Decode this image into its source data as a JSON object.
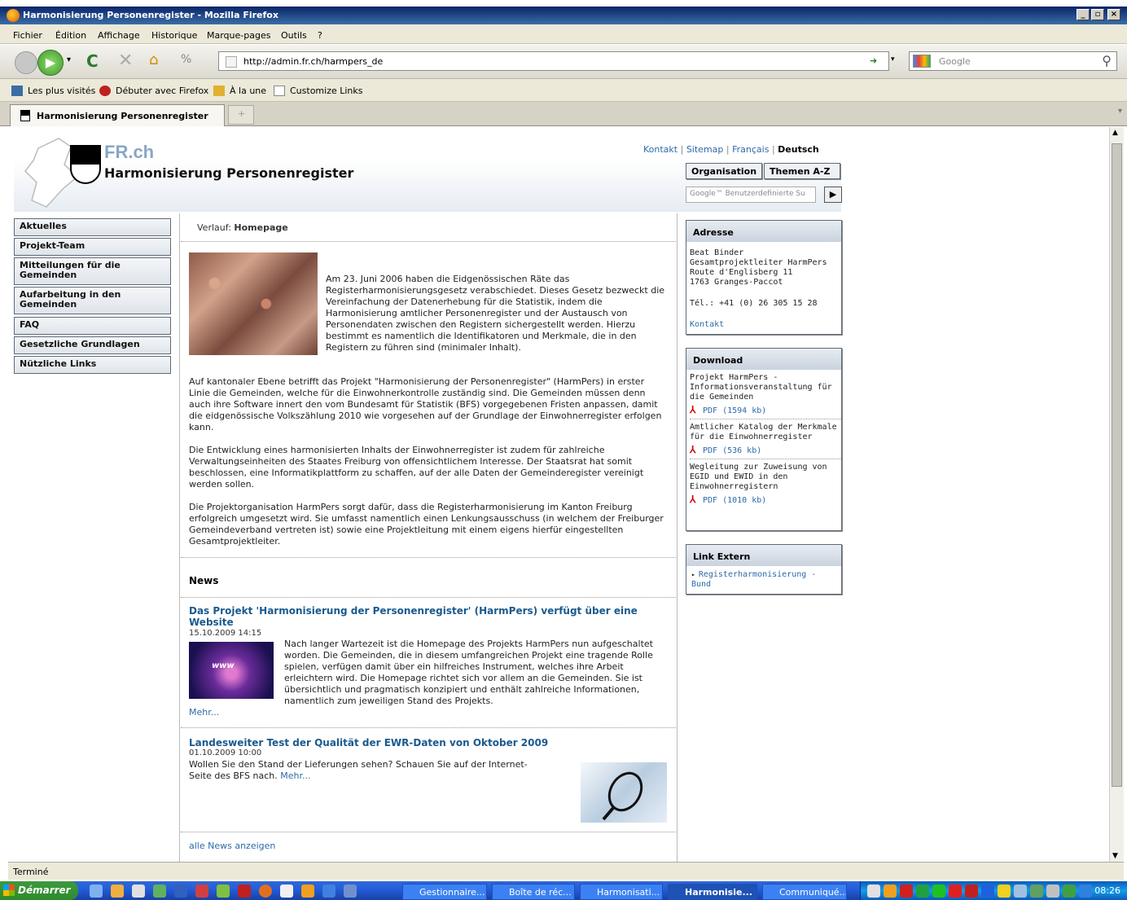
{
  "window": {
    "title": "Harmonisierung Personenregister - Mozilla Firefox",
    "controls": [
      "_",
      "▫",
      "×"
    ]
  },
  "menu": [
    "Fichier",
    "Édition",
    "Affichage",
    "Historique",
    "Marque-pages",
    "Outils",
    "?"
  ],
  "nav": {
    "url": "http://admin.fr.ch/harmpers_de",
    "search_placeholder": "Google"
  },
  "bookmarks": [
    "Les plus visités",
    "Débuter avec Firefox",
    "À la une",
    "Customize Links"
  ],
  "tab": {
    "label": "Harmonisierung Personenregister"
  },
  "site": {
    "logo": "FR.ch",
    "title": "Harmonisierung Personenregister",
    "toplinks": {
      "kontakt": "Kontakt",
      "sitemap": "Sitemap",
      "francais": "Français",
      "deutsch": "Deutsch",
      "sep": "|"
    },
    "buttons": {
      "organisation": "Organisation",
      "themen": "Themen A-Z"
    },
    "search_placeholder": "Google™ Benutzerdefinierte Su",
    "search_go": "▶"
  },
  "leftnav": [
    "Aktuelles",
    "Projekt-Team",
    "Mitteilungen für die Gemeinden",
    "Aufarbeitung in den Gemeinden",
    "FAQ",
    "Gesetzliche Grundlagen",
    "Nützliche Links"
  ],
  "main": {
    "crumb_label": "Verlauf:",
    "crumb_value": "Homepage",
    "intro": "Am 23. Juni 2006 haben die Eidgenössischen Räte das Registerharmonisierungsgesetz verabschiedet. Dieses Gesetz bezweckt die Vereinfachung der Datenerhebung für die Statistik, indem die Harmonisierung amtlicher Personenregister und der Austausch von Personendaten zwischen den Registern sichergestellt werden. Hierzu bestimmt es namentlich die Identifikatoren und Merkmale, die in den Registern zu führen sind (minimaler Inhalt).",
    "p1": "Auf kantonaler Ebene betrifft das Projekt \"Harmonisierung der Personenregister\" (HarmPers) in erster Linie die Gemeinden, welche für die Einwohnerkontrolle zuständig sind. Die Gemeinden müssen denn auch ihre Software innert den vom Bundesamt für Statistik (BFS) vorgegebenen Fristen anpassen, damit die eidgenössische Volkszählung 2010 wie vorgesehen auf der Grundlage der Einwohnerregister erfolgen kann.",
    "p2": "Die Entwicklung eines harmonisierten Inhalts der Einwohnerregister ist zudem für zahlreiche Verwaltungseinheiten des Staates Freiburg von offensichtlichem Interesse. Der Staatsrat hat somit beschlossen, eine Informatikplattform zu schaffen, auf der alle Daten der Gemeinderegister vereinigt werden sollen.",
    "p3": "Die Projektorganisation HarmPers sorgt dafür, dass die Registerharmonisierung im Kanton Freiburg erfolgreich umgesetzt wird. Sie umfasst namentlich einen Lenkungsausschuss (in welchem der Freiburger Gemeindeverband vertreten ist) sowie eine Projektleitung mit einem eigens hierfür eingestellten Gesamtprojektleiter.",
    "news_heading": "News",
    "news": [
      {
        "title": "Das Projekt 'Harmonisierung der Personenregister' (HarmPers) verfügt über eine Website",
        "date": "15.10.2009 14:15",
        "text": "Nach langer Wartezeit ist die Homepage des Projekts HarmPers nun aufgeschaltet worden. Die Gemeinden, die in diesem umfangreichen Projekt eine tragende Rolle spielen, verfügen damit über ein hilfreiches Instrument, welches ihre Arbeit erleichtern wird. Die Homepage richtet sich vor allem an die Gemeinden. Sie ist übersichtlich und pragmatisch konzipiert und enthält zahlreiche Informationen, namentlich zum jeweiligen Stand des Projekts.",
        "more": "Mehr..."
      },
      {
        "title": "Landesweiter Test der Qualität der EWR-Daten von Oktober 2009",
        "date": "01.10.2009 10:00",
        "text": "Wollen Sie den Stand der Lieferungen sehen? Schauen Sie auf der Internet-Seite des BFS nach.",
        "more": "Mehr..."
      }
    ],
    "all_news": "alle News anzeigen"
  },
  "right": {
    "adresse": {
      "head": "Adresse",
      "lines": [
        "Beat Binder",
        "Gesamtprojektleiter HarmPers",
        "Route d'Englisberg 11",
        "1763 Granges-Paccot"
      ],
      "tel": "Tél.: +41 (0) 26 305 15 28",
      "kontakt": "Kontakt"
    },
    "download": {
      "head": "Download",
      "items": [
        {
          "title": "Projekt HarmPers - Informationsveranstaltung für die Gemeinden",
          "pdf": "PDF (1594 kb)"
        },
        {
          "title": "Amtlicher Katalog der Merkmale für die Einwohnerregister",
          "pdf": "PDF (536 kb)"
        },
        {
          "title": "Wegleitung zur Zuweisung von EGID und EWID in den Einwohnerregistern",
          "pdf": "PDF (1010 kb)"
        }
      ]
    },
    "links": {
      "head": "Link Extern",
      "item": "Registerharmonisierung - Bund"
    }
  },
  "status": "Terminé",
  "taskbar": {
    "start": "Démarrer",
    "tasks": [
      "Gestionnaire...",
      "Boîte de réc...",
      "Harmonisati...",
      "Harmonisie...",
      "Communiqué..."
    ],
    "clock": "08:26"
  }
}
